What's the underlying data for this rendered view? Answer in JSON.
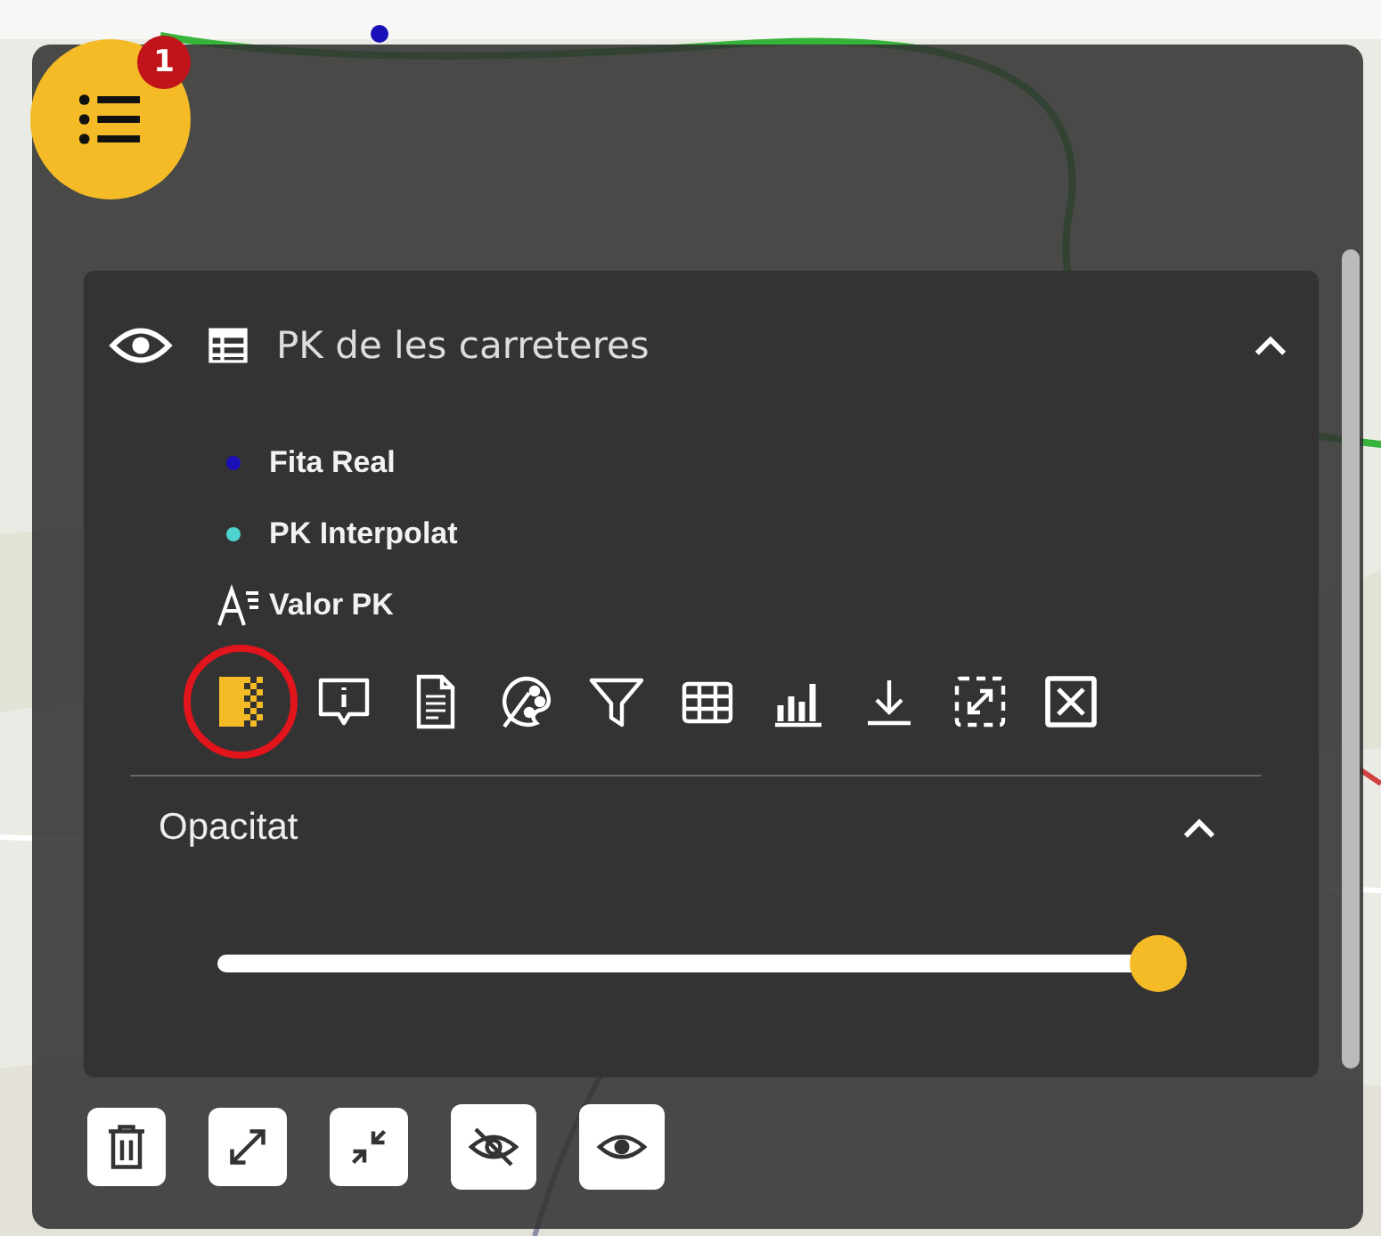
{
  "menu_button": {
    "badge": "1"
  },
  "layer": {
    "title": "PK de les carreteres",
    "visible": true,
    "expanded": true,
    "legend": [
      {
        "kind": "dot",
        "label": "Fita Real",
        "color": "#1a10b8"
      },
      {
        "kind": "dot",
        "label": "PK Interpolat",
        "color": "#4fd3d0"
      },
      {
        "kind": "text",
        "label": "Valor PK"
      }
    ],
    "tools": [
      {
        "kind": "opacity",
        "selected": true
      },
      {
        "kind": "info",
        "selected": false
      },
      {
        "kind": "metadata",
        "selected": false
      },
      {
        "kind": "style",
        "selected": false
      },
      {
        "kind": "filter",
        "selected": false
      },
      {
        "kind": "table",
        "selected": false
      },
      {
        "kind": "chart",
        "selected": false
      },
      {
        "kind": "download",
        "selected": false
      },
      {
        "kind": "zoom",
        "selected": false
      },
      {
        "kind": "remove",
        "selected": false
      }
    ],
    "opacity": {
      "title": "Opacitat",
      "expanded": true,
      "level": 1
    }
  },
  "actions": [
    {
      "kind": "delete"
    },
    {
      "kind": "expand"
    },
    {
      "kind": "collapse"
    },
    {
      "kind": "hide"
    },
    {
      "kind": "show"
    }
  ]
}
